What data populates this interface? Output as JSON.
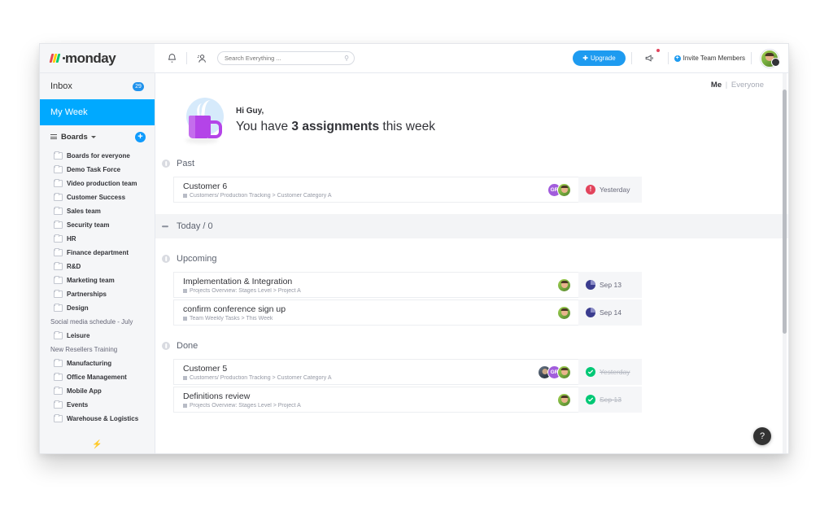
{
  "brand": {
    "name": "monday",
    "logo_colors": [
      "#e8454f",
      "#ffcb00",
      "#00ca72"
    ]
  },
  "topbar": {
    "notifications_icon": "bell-icon",
    "invite_people_icon": "person-add-icon",
    "search": {
      "placeholder": "Search Everything ...",
      "value": "",
      "icon": "magnifier-icon"
    },
    "upgrade_label": "Upgrade",
    "upgrade_color": "#1e9bf0",
    "megaphone_icon": "megaphone-icon",
    "invite_label": "Invite Team Members",
    "avatar": "user-avatar"
  },
  "sidebar": {
    "inbox": {
      "label": "Inbox",
      "badge": "29"
    },
    "my_week": {
      "label": "My Week",
      "active": true,
      "color": "#00a9ff"
    },
    "boards_header": {
      "label": "Boards",
      "add_label": "+"
    },
    "boards": [
      {
        "label": "Boards for everyone",
        "type": "board"
      },
      {
        "label": "Demo Task Force",
        "type": "board"
      },
      {
        "label": "Video production team",
        "type": "board"
      },
      {
        "label": "Customer Success",
        "type": "board"
      },
      {
        "label": "Sales team",
        "type": "board"
      },
      {
        "label": "Security team",
        "type": "board"
      },
      {
        "label": "HR",
        "type": "board"
      },
      {
        "label": "Finance department",
        "type": "board"
      },
      {
        "label": "R&D",
        "type": "board"
      },
      {
        "label": "Marketing team",
        "type": "board"
      },
      {
        "label": "Partnerships",
        "type": "board"
      },
      {
        "label": "Design",
        "type": "board"
      },
      {
        "label": "Social media schedule - July",
        "type": "plain"
      },
      {
        "label": "Leisure",
        "type": "board"
      },
      {
        "label": "New Resellers Training",
        "type": "plain"
      },
      {
        "label": "Manufacturing",
        "type": "board"
      },
      {
        "label": "Office Management",
        "type": "board"
      },
      {
        "label": "Mobile App",
        "type": "board"
      },
      {
        "label": "Events",
        "type": "board"
      },
      {
        "label": "Warehouse & Logistics",
        "type": "board"
      }
    ],
    "footer_icon": "lightning-icon"
  },
  "main": {
    "view_toggle": {
      "me": "Me",
      "separator": "|",
      "everyone": "Everyone"
    },
    "greeting": {
      "hello": "Hi Guy,",
      "line_prefix": "You have ",
      "line_highlight": "3 assignments",
      "line_suffix": " this week",
      "illustration": "coffee-mug-icon"
    },
    "sections": [
      {
        "id": "past",
        "title": "Past",
        "banded": false,
        "tasks": [
          {
            "title": "Customer 6",
            "path": "Customers/ Production Tracking > Customer Category A",
            "avatars": [
              {
                "type": "initials",
                "text": "GR"
              },
              {
                "type": "photo",
                "text": ""
              }
            ],
            "status": "overdue",
            "status_icon": "exclamation-icon",
            "date": "Yesterday"
          }
        ]
      },
      {
        "id": "today",
        "title": "Today / 0",
        "banded": true,
        "tasks": []
      },
      {
        "id": "upcoming",
        "title": "Upcoming",
        "banded": false,
        "tasks": [
          {
            "title": "Implementation & Integration",
            "path": "Projects Overview: Stages Level > Project A",
            "avatars": [
              {
                "type": "photo",
                "text": ""
              }
            ],
            "status": "upcoming",
            "status_icon": "clock-icon",
            "date": "Sep 13"
          },
          {
            "title": "confirm conference sign up",
            "path": "Team Weekly Tasks > This Week",
            "avatars": [
              {
                "type": "photo",
                "text": ""
              }
            ],
            "status": "upcoming",
            "status_icon": "clock-icon",
            "date": "Sep 14"
          }
        ]
      },
      {
        "id": "done",
        "title": "Done",
        "banded": false,
        "tasks": [
          {
            "title": "Customer 5",
            "path": "Customers/ Production Tracking > Customer Category A",
            "avatars": [
              {
                "type": "dark",
                "text": ""
              },
              {
                "type": "initials",
                "text": "GR"
              },
              {
                "type": "photo",
                "text": ""
              }
            ],
            "status": "done",
            "status_icon": "check-icon",
            "date": "Yesterday"
          },
          {
            "title": "Definitions review",
            "path": "Projects Overview: Stages Level > Project A",
            "avatars": [
              {
                "type": "photo",
                "text": ""
              }
            ],
            "status": "done",
            "status_icon": "check-icon",
            "date": "Sep 13"
          }
        ]
      }
    ],
    "help_label": "?"
  },
  "colors": {
    "accent": "#00a9ff",
    "upgrade": "#1e9bf0",
    "overdue": "#e2445c",
    "done": "#00c875",
    "upcoming": "#3b3d8f",
    "purple_avatar": "#a25ddc"
  }
}
